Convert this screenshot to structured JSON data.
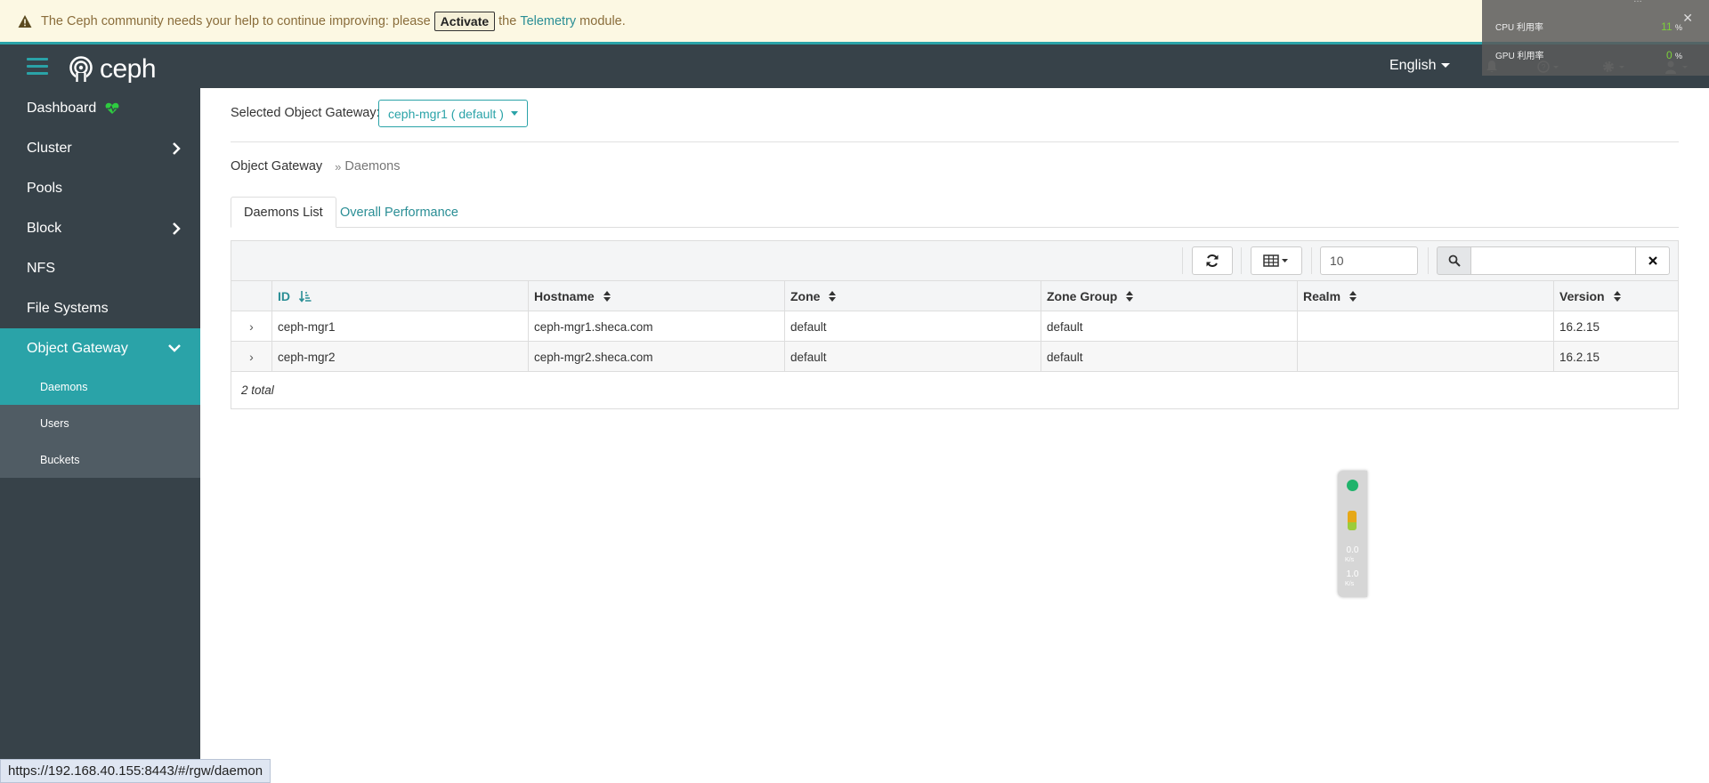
{
  "banner": {
    "text_before": "The Ceph community needs your help to continue improving: please",
    "activate_label": "Activate",
    "text_mid": "the",
    "telemetry_link": "Telemetry",
    "text_after": "module."
  },
  "header": {
    "logo": "ceph",
    "language": "English"
  },
  "perf_overlay": {
    "top_label": "…",
    "cpu_label": "CPU 利用率",
    "cpu_value": "11",
    "cpu_unit": "%",
    "gpu_label": "GPU 利用率",
    "gpu_value": "0",
    "gpu_unit": "%"
  },
  "sidebar": {
    "items": [
      {
        "label": "Dashboard"
      },
      {
        "label": "Cluster"
      },
      {
        "label": "Pools"
      },
      {
        "label": "Block"
      },
      {
        "label": "NFS"
      },
      {
        "label": "File Systems"
      },
      {
        "label": "Object Gateway"
      }
    ],
    "subitems": [
      {
        "label": "Daemons"
      },
      {
        "label": "Users"
      },
      {
        "label": "Buckets"
      }
    ]
  },
  "gateway": {
    "label": "Selected Object Gateway:",
    "selected": "ceph-mgr1 ( default )"
  },
  "breadcrumb": {
    "parent": "Object Gateway",
    "sep": "»",
    "current": "Daemons"
  },
  "tabs": [
    {
      "label": "Daemons List"
    },
    {
      "label": "Overall Performance"
    }
  ],
  "table": {
    "page_size": "10",
    "search_value": "",
    "columns": [
      "ID",
      "Hostname",
      "Zone",
      "Zone Group",
      "Realm",
      "Version"
    ],
    "rows": [
      {
        "id": "ceph-mgr1",
        "hostname": "ceph-mgr1.sheca.com",
        "zone": "default",
        "zonegroup": "default",
        "realm": "",
        "version": "16.2.15"
      },
      {
        "id": "ceph-mgr2",
        "hostname": "ceph-mgr2.sheca.com",
        "zone": "default",
        "zonegroup": "default",
        "realm": "",
        "version": "16.2.15"
      }
    ],
    "total": "2 total"
  },
  "widget": {
    "upload_value": "0.0",
    "upload_unit": "K/s",
    "download_value": "1.0",
    "download_unit": "K/s"
  },
  "status_url": "https://192.168.40.155:8443/#/rgw/daemon",
  "colors": {
    "accent": "#2aa3a8",
    "sidebar": "#374249",
    "banner_bg": "#fcf8e3",
    "heart": "#2ecc40"
  }
}
